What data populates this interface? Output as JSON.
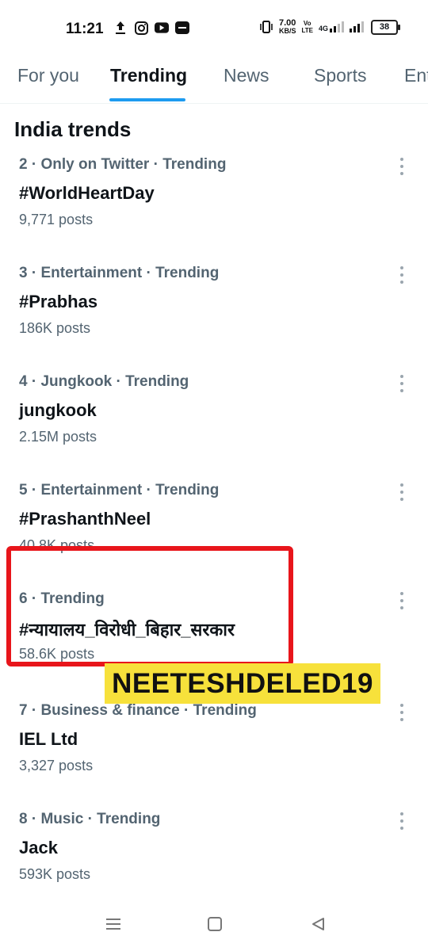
{
  "status_bar": {
    "time": "11:21",
    "net_speed_value": "7.00",
    "net_speed_unit": "KB/S",
    "volte_top": "Vo",
    "volte_bottom": "LTE",
    "network": "4G",
    "battery": "38"
  },
  "tabs": [
    {
      "label": "For you",
      "active": false
    },
    {
      "label": "Trending",
      "active": true
    },
    {
      "label": "News",
      "active": false
    },
    {
      "label": "Sports",
      "active": false
    },
    {
      "label": "Ent",
      "active": false
    }
  ],
  "section_title": "India trends",
  "trends": [
    {
      "meta": "2 · Only on Twitter · Trending",
      "name": "#WorldHeartDay",
      "count": "9,771 posts"
    },
    {
      "meta": "3 · Entertainment · Trending",
      "name": "#Prabhas",
      "count": "186K posts"
    },
    {
      "meta": "4 · Jungkook · Trending",
      "name": "jungkook",
      "count": "2.15M posts"
    },
    {
      "meta": "5 · Entertainment · Trending",
      "name": "#PrashanthNeel",
      "count": "40.8K posts"
    },
    {
      "meta": "6 · Trending",
      "name": "#न्यायालय_विरोधी_बिहार_सरकार",
      "count": "58.6K posts"
    },
    {
      "meta": "7 · Business & finance · Trending",
      "name": "IEL Ltd",
      "count": "3,327 posts"
    },
    {
      "meta": "8 · Music · Trending",
      "name": "Jack",
      "count": "593K posts"
    }
  ],
  "watermark": "NEETESHDELED19",
  "colors": {
    "accent": "#1d9bf0",
    "highlight_border": "#e8151b",
    "watermark_bg": "#f7e13b"
  },
  "icons": {
    "upload": "upload-icon",
    "instagram": "instagram-icon",
    "youtube": "youtube-icon",
    "app": "app-icon",
    "vibrate": "vibrate-icon",
    "signal": "signal-icon",
    "more": "more-vertical-icon",
    "nav_menu": "menu-icon",
    "nav_home": "home-square-icon",
    "nav_back": "back-triangle-icon"
  }
}
